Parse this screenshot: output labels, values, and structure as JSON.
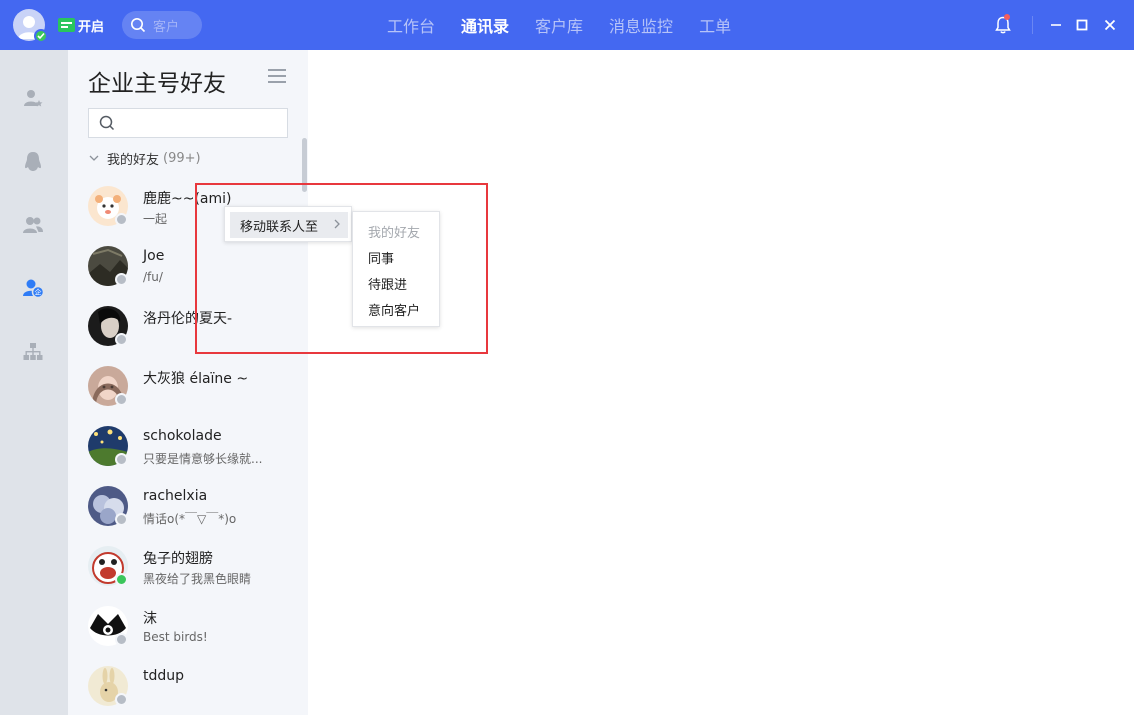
{
  "titlebar": {
    "status_label": "开启",
    "search_placeholder": "客户",
    "tabs": [
      {
        "label": "工作台",
        "active": false
      },
      {
        "label": "通讯录",
        "active": true
      },
      {
        "label": "客户库",
        "active": false
      },
      {
        "label": "消息监控",
        "active": false
      },
      {
        "label": "工单",
        "active": false
      }
    ],
    "accent": "#4468f1",
    "notification_badge": true
  },
  "rail": {
    "items": [
      {
        "icon": "contact-star-icon",
        "active": false
      },
      {
        "icon": "qq-penguin-icon",
        "active": false
      },
      {
        "icon": "group-users-icon",
        "active": false
      },
      {
        "icon": "enterprise-account-icon",
        "active": true
      },
      {
        "icon": "org-chart-icon",
        "active": false
      }
    ]
  },
  "panel": {
    "title": "企业主号好友",
    "group": {
      "name": "我的好友",
      "count": "(99+)"
    },
    "contacts": [
      {
        "name": "鹿鹿~~(ami)",
        "sub": "一起",
        "online": false
      },
      {
        "name": "Joe",
        "sub": "/fu/",
        "online": false
      },
      {
        "name": "洛丹伦的夏天-",
        "sub": "",
        "online": false
      },
      {
        "name": "大灰狼 élaïne ~",
        "sub": "",
        "online": false
      },
      {
        "name": "schokolade",
        "sub": "只要是情意够长缘就...",
        "online": false
      },
      {
        "name": "rachelxia",
        "sub": "情话o(*￣▽￣*)o",
        "online": false
      },
      {
        "name": "兔子的翅膀",
        "sub": "黑夜给了我黑色眼睛",
        "online": true
      },
      {
        "name": " 沫",
        "sub": "Best birds!",
        "online": false
      },
      {
        "name": "tddup",
        "sub": "",
        "online": false
      }
    ]
  },
  "context_menu": {
    "item": "移动联系人至",
    "submenu": [
      {
        "label": "我的好友",
        "disabled": true
      },
      {
        "label": "同事",
        "disabled": false
      },
      {
        "label": "待跟进",
        "disabled": false
      },
      {
        "label": "意向客户",
        "disabled": false
      }
    ]
  }
}
